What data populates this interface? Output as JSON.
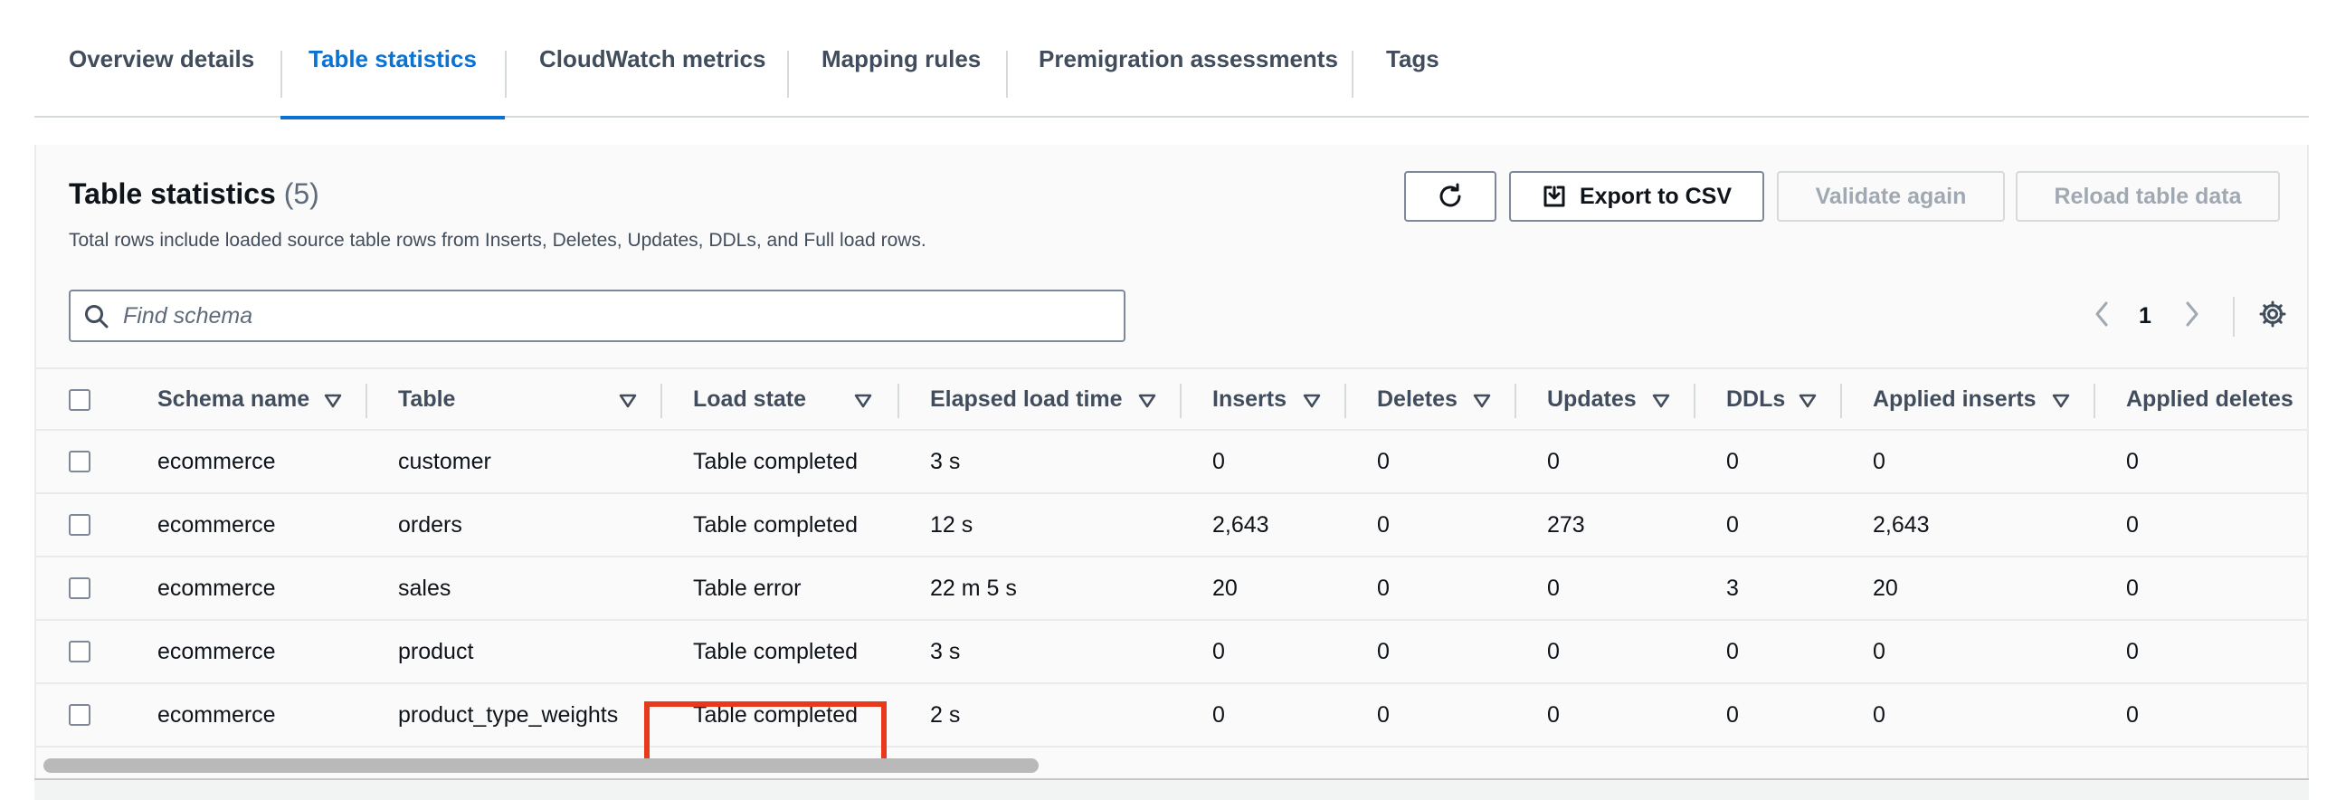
{
  "tabs": [
    {
      "label": "Overview details",
      "active": false
    },
    {
      "label": "Table statistics",
      "active": true
    },
    {
      "label": "CloudWatch metrics",
      "active": false
    },
    {
      "label": "Mapping rules",
      "active": false
    },
    {
      "label": "Premigration assessments",
      "active": false
    },
    {
      "label": "Tags",
      "active": false
    }
  ],
  "header": {
    "title": "Table statistics",
    "count": "(5)",
    "description": "Total rows include loaded source table rows from Inserts, Deletes, Updates, DDLs, and Full load rows."
  },
  "actions": {
    "refresh_icon": "refresh-icon",
    "export_label": "Export to CSV",
    "export_icon": "download-icon",
    "validate_label": "Validate again",
    "reload_label": "Reload table data"
  },
  "search": {
    "placeholder": "Find schema",
    "value": ""
  },
  "pagination": {
    "current_page": "1"
  },
  "columns": [
    "Schema name",
    "Table",
    "Load state",
    "Elapsed load time",
    "Inserts",
    "Deletes",
    "Updates",
    "DDLs",
    "Applied inserts",
    "Applied deletes"
  ],
  "rows": [
    {
      "schema": "ecommerce",
      "table": "customer",
      "load_state": "Table completed",
      "elapsed": "3 s",
      "inserts": "0",
      "deletes": "0",
      "updates": "0",
      "ddls": "0",
      "applied_inserts": "0",
      "applied_deletes": "0"
    },
    {
      "schema": "ecommerce",
      "table": "orders",
      "load_state": "Table completed",
      "elapsed": "12 s",
      "inserts": "2,643",
      "deletes": "0",
      "updates": "273",
      "ddls": "0",
      "applied_inserts": "2,643",
      "applied_deletes": "0"
    },
    {
      "schema": "ecommerce",
      "table": "sales",
      "load_state": "Table error",
      "elapsed": "22 m 5 s",
      "inserts": "20",
      "deletes": "0",
      "updates": "0",
      "ddls": "3",
      "applied_inserts": "20",
      "applied_deletes": "0"
    },
    {
      "schema": "ecommerce",
      "table": "product",
      "load_state": "Table completed",
      "elapsed": "3 s",
      "inserts": "0",
      "deletes": "0",
      "updates": "0",
      "ddls": "0",
      "applied_inserts": "0",
      "applied_deletes": "0"
    },
    {
      "schema": "ecommerce",
      "table": "product_type_weights",
      "load_state": "Table completed",
      "elapsed": "2 s",
      "inserts": "0",
      "deletes": "0",
      "updates": "0",
      "ddls": "0",
      "applied_inserts": "0",
      "applied_deletes": "0"
    }
  ],
  "colors": {
    "accent": "#0972d3",
    "highlight": "#e8391d"
  }
}
